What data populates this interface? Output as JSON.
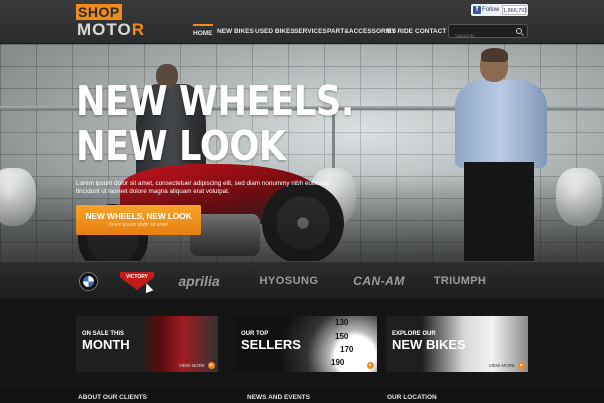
{
  "header": {
    "logo_top": "SHOP",
    "logo_bottom_main": "MOTO",
    "logo_bottom_accent": "R",
    "social_follow": "Follow",
    "social_count": "1,866,701",
    "nav": [
      "HOME",
      "NEW BIKES",
      "USED BIKES",
      "SERVICES",
      "PART&ACCESSORIES",
      "MY RIDE",
      "CONTACT"
    ],
    "search_placeholder": "Search"
  },
  "hero": {
    "title_line1": "NEW WHEELS.",
    "title_line2": "NEW LOOK",
    "text": "Lorem ipsum dolor sit amet, consectetuer adipiscing elit, sed diam nonummy nibh euismod tincidunt ut laoreet dolore magna aliquam erat volutpat.",
    "button_label": "NEW WHEELS, NEW LOOK",
    "button_sub": "lorem ipsum dolor sit amet"
  },
  "brands": {
    "victory": "VICTORY",
    "aprilia": "aprilia",
    "hyosung": "HYOSUNG",
    "canam": "CAN-AM",
    "triumph": "TRIUMPH"
  },
  "cards": [
    {
      "small": "ON SALE THIS",
      "big": "MONTH",
      "more": "VIEW MORE"
    },
    {
      "small": "OUR TOP",
      "big": "SELLERS",
      "more": "VIEW MORE"
    },
    {
      "small": "EXPLORE OUR",
      "big": "NEW BIKES",
      "more": "VIEW MORE"
    }
  ],
  "speedo": [
    "130",
    "150",
    "170",
    "190"
  ],
  "footer": {
    "about": "ABOUT OUR CLIENTS",
    "news": "NEWS AND EVENTS",
    "location": "OUR LOCATION"
  },
  "colors": {
    "accent": "#f08a1c",
    "header_bg": "#2f3032",
    "body_bg": "#151515"
  }
}
